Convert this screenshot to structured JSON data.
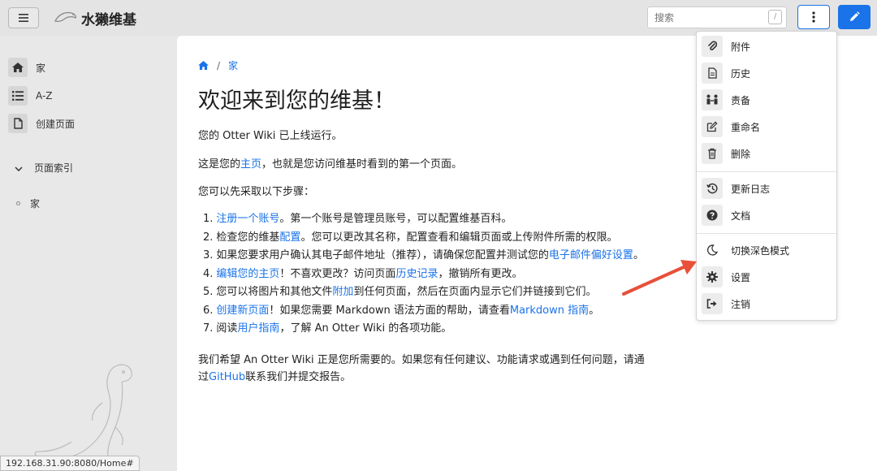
{
  "header": {
    "brand": "水獭维基",
    "search_placeholder": "搜索",
    "search_shortcut": "/",
    "menu_icon": "hamburger-icon",
    "more_icon": "vertical-dots-icon",
    "edit_icon": "pencil-icon"
  },
  "sidebar": {
    "items": [
      {
        "label": "家",
        "icon": "home-icon"
      },
      {
        "label": "A-Z",
        "icon": "list-icon"
      },
      {
        "label": "创建页面",
        "icon": "file-icon"
      }
    ],
    "section": "页面索引",
    "index_items": [
      "家"
    ]
  },
  "statusbar": "192.168.31.90:8080/Home#",
  "content": {
    "breadcrumb": {
      "sep": "/",
      "current": "家"
    },
    "title": "欢迎来到您的维基！",
    "p1": "您的 Otter Wiki 已上线运行。",
    "p2": {
      "pre": "这是您的",
      "link": "主页",
      "post": "，也就是您访问维基时看到的第一个页面。"
    },
    "p3": "您可以先采取以下步骤：",
    "steps": [
      {
        "num": "1.",
        "parts": [
          {
            "t": "注册一个账号",
            "link": true
          },
          {
            "t": "。第一个账号是管理员账号，可以配置维基百科。"
          }
        ]
      },
      {
        "num": "2.",
        "parts": [
          {
            "t": "检查您的维基"
          },
          {
            "t": "配置",
            "link": true
          },
          {
            "t": "。您可以更改其名称，配置查看和编辑页面或上传附件所需的权限。"
          }
        ]
      },
      {
        "num": "3.",
        "parts": [
          {
            "t": "如果您要求用户确认其电子邮件地址（推荐），请确保您配置并测试您的"
          },
          {
            "t": "电子邮件偏好设置",
            "link": true
          },
          {
            "t": "。"
          }
        ]
      },
      {
        "num": "4.",
        "parts": [
          {
            "t": "编辑您的主页",
            "link": true
          },
          {
            "t": "！不喜欢更改？访问页面"
          },
          {
            "t": "历史记录",
            "link": true
          },
          {
            "t": "，撤销所有更改。"
          }
        ]
      },
      {
        "num": "5.",
        "parts": [
          {
            "t": "您可以将图片和其他文件"
          },
          {
            "t": "附加",
            "link": true
          },
          {
            "t": "到任何页面，然后在页面内显示它们并链接到它们。"
          }
        ]
      },
      {
        "num": "6.",
        "parts": [
          {
            "t": "创建新页面",
            "link": true
          },
          {
            "t": "！如果您需要 Markdown 语法方面的帮助，请查看"
          },
          {
            "t": "Markdown 指南",
            "link": true
          },
          {
            "t": "。"
          }
        ]
      },
      {
        "num": "7.",
        "parts": [
          {
            "t": "阅读"
          },
          {
            "t": "用户指南",
            "link": true
          },
          {
            "t": "，了解 An Otter Wiki 的各项功能。"
          }
        ]
      }
    ],
    "p4_line1": "我们希望 An Otter Wiki 正是您所需要的。如果您有任何建议、功能请求或遇到任何问题，请通",
    "p4_line2": {
      "pre": "过",
      "link": "GitHub",
      "post": "联系我们并提交报告。"
    }
  },
  "dropdown": {
    "items": [
      {
        "label": "附件",
        "icon": "paperclip-icon"
      },
      {
        "label": "历史",
        "icon": "document-icon"
      },
      {
        "label": "责备",
        "icon": "users-icon"
      },
      {
        "label": "重命名",
        "icon": "edit-icon"
      },
      {
        "label": "删除",
        "icon": "trash-icon"
      },
      {
        "label": "更新日志",
        "icon": "history-icon"
      },
      {
        "label": "文档",
        "icon": "question-icon"
      },
      {
        "label": "切换深色模式",
        "icon": "moon-icon"
      },
      {
        "label": "设置",
        "icon": "gear-icon"
      },
      {
        "label": "注销",
        "icon": "logout-icon"
      }
    ]
  },
  "colors": {
    "accent": "#1a73e8",
    "annotation_arrow": "#e8503a"
  }
}
